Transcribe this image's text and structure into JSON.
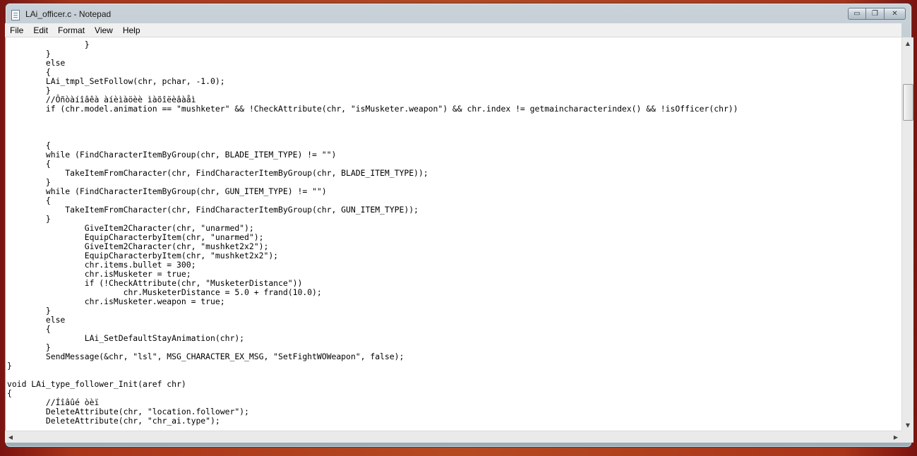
{
  "window": {
    "title": "LAi_officer.c - Notepad",
    "buttons": {
      "minimize": "▭",
      "maximize": "❐",
      "close": "✕"
    }
  },
  "menu": [
    "File",
    "Edit",
    "Format",
    "View",
    "Help"
  ],
  "editor": {
    "lines": [
      "\t\t}",
      "\t}",
      "\telse",
      "\t{",
      "\tLAi_tmpl_SetFollow(chr, pchar, -1.0);",
      "\t}",
      "\t//Ôñòàíîâêà àíèìàöèè ìàõîëèâàåì",
      "\tif (chr.model.animation == \"mushketer\" && !CheckAttribute(chr, \"isMusketer.weapon\") && chr.index != getmaincharacterindex() && !isOfficer(chr))",
      "",
      "",
      "",
      "\t{",
      "\twhile (FindCharacterItemByGroup(chr, BLADE_ITEM_TYPE) != \"\")",
      "\t{",
      "\t    TakeItemFromCharacter(chr, FindCharacterItemByGroup(chr, BLADE_ITEM_TYPE));",
      "\t}",
      "\twhile (FindCharacterItemByGroup(chr, GUN_ITEM_TYPE) != \"\")",
      "\t{",
      "\t    TakeItemFromCharacter(chr, FindCharacterItemByGroup(chr, GUN_ITEM_TYPE));",
      "\t}",
      "\t\tGiveItem2Character(chr, \"unarmed\");",
      "\t\tEquipCharacterbyItem(chr, \"unarmed\");",
      "\t\tGiveItem2Character(chr, \"mushket2x2\");",
      "\t\tEquipCharacterbyItem(chr, \"mushket2x2\");",
      "\t\tchr.items.bullet = 300;",
      "\t\tchr.isMusketer = true;",
      "\t\tif (!CheckAttribute(chr, \"MusketerDistance\"))",
      "\t\t\tchr.MusketerDistance = 5.0 + frand(10.0);",
      "\t\tchr.isMusketer.weapon = true;",
      "\t}",
      "\telse",
      "\t{",
      "\t\tLAi_SetDefaultStayAnimation(chr);",
      "\t}",
      "\tSendMessage(&chr, \"lsl\", MSG_CHARACTER_EX_MSG, \"SetFightWOWeapon\", false);",
      "}",
      "",
      "void LAi_type_follower_Init(aref chr)",
      "{",
      "\t//Íîâûé òèï",
      "\tDeleteAttribute(chr, \"location.follower\");",
      "\tDeleteAttribute(chr, \"chr_ai.type\");"
    ]
  },
  "scrollbars": {
    "up": "▲",
    "down": "▼",
    "left": "◀",
    "right": "▶"
  }
}
